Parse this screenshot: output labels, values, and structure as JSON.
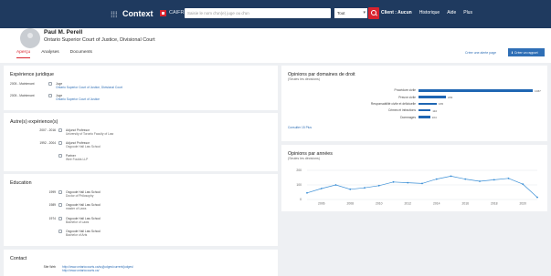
{
  "nav": {
    "brand": "Context",
    "canlii": "CAIFRE",
    "search_placeholder": "Saisie le nom d'un(e) juge ou d'un",
    "scope": "Tout",
    "links": [
      "Client : Aucun",
      "Historique",
      "Aide",
      "Plus"
    ]
  },
  "header": {
    "name": "Paul M. Perell",
    "court": "Ontario Superior Court of Justice, Divisional Court",
    "tabs": [
      "Aperçu",
      "Analyses",
      "Documents"
    ],
    "alert": "Créer une alerte page",
    "report": "Créer un rapport"
  },
  "experience": {
    "title": "Expérience juridique",
    "items": [
      {
        "date": "2005 - Maintenant",
        "role": "Juge",
        "org": "Ontario Superior Court of Justice, Divisional Court"
      },
      {
        "date": "2005 - Maintenant",
        "role": "Juge",
        "org": "Ontario Superior Court of Justice"
      }
    ]
  },
  "other_experience": {
    "title": "Autre(s) expérience(s)",
    "items": [
      {
        "date": "2007 - 2016",
        "role": "Adjunct Professor",
        "org": "University of Toronto Faculty of Law"
      },
      {
        "date": "1992 - 2004",
        "role": "Adjunct Professor",
        "org": "Osgoode Hall Law School"
      },
      {
        "date": "",
        "role": "Partner",
        "org": "Weir Foulds LLP"
      }
    ]
  },
  "education": {
    "title": "Education",
    "items": [
      {
        "year": "1999",
        "school": "Osgoode Hall Law School",
        "degree": "Doctor of Philosophy"
      },
      {
        "year": "1989",
        "school": "Osgoode Hall Law School",
        "degree": "master of Laws"
      },
      {
        "year": "1974",
        "school": "Osgoode Hall Law School",
        "degree": "Bachelor of Laws"
      },
      {
        "year": "",
        "school": "Osgoode Hall Law School",
        "degree": "Bachelor of Arts"
      }
    ]
  },
  "contact": {
    "title": "Contact",
    "label": "Site Web",
    "links": [
      "http://www.ontariocourts.ca/scj/judges/current/judges/",
      "http://www.ontariocourts.ca/"
    ]
  },
  "chart_data": [
    {
      "type": "bar",
      "orientation": "horizontal",
      "title": "Opinions par domaines de droit",
      "subtitle": "(Seules les décisions)",
      "categories": [
        "Procédure civile",
        "Preuve civile",
        "Responsabilité civile et délictuelle",
        "Crimes et infractions",
        "Dommages"
      ],
      "values": [
        1037,
        249,
        165,
        110,
        104
      ],
      "link": "Consulter 15 Plus",
      "colors": {
        "bar": "#1f66b3"
      }
    },
    {
      "type": "line",
      "title": "Opinions par années",
      "subtitle": "(Seules les décisions)",
      "x": [
        2005,
        2006,
        2007,
        2008,
        2009,
        2010,
        2011,
        2012,
        2013,
        2014,
        2015,
        2016,
        2017,
        2018,
        2019,
        2020,
        2021
      ],
      "y": [
        45,
        75,
        100,
        70,
        80,
        95,
        120,
        115,
        110,
        140,
        160,
        140,
        125,
        135,
        145,
        105,
        15
      ],
      "xticks": [
        "2006",
        "2008",
        "2010",
        "2012",
        "2014",
        "2016",
        "2018",
        "2020"
      ],
      "yticks": [
        "0",
        "100",
        "200"
      ],
      "ylim": [
        0,
        200
      ],
      "colors": {
        "line": "#3b8fd6"
      }
    }
  ]
}
